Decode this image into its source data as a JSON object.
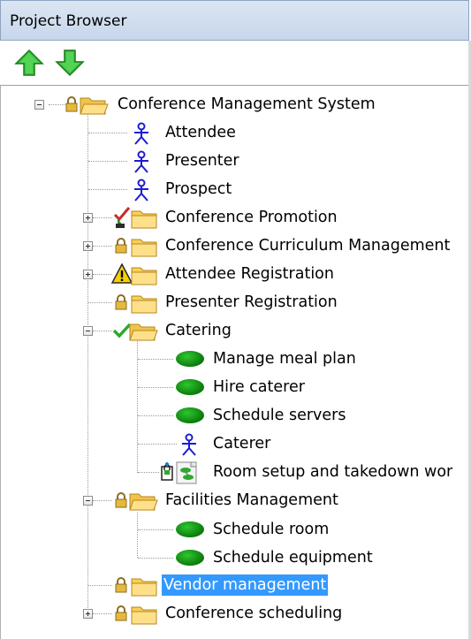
{
  "window": {
    "title": "Project Browser"
  },
  "toolbar": {
    "move_up_icon": "green-up-arrow",
    "move_down_icon": "green-down-arrow"
  },
  "tree": {
    "root": {
      "label": "Conference Management System",
      "state": "expanded",
      "children": [
        {
          "label": "Attendee",
          "icon": "actor"
        },
        {
          "label": "Presenter",
          "icon": "actor"
        },
        {
          "label": "Prospect",
          "icon": "actor"
        },
        {
          "label": "Conference Promotion",
          "icon": "package-checked-out",
          "state": "collapsed"
        },
        {
          "label": "Conference Curriculum Management",
          "icon": "package-locked",
          "state": "collapsed"
        },
        {
          "label": "Attendee Registration",
          "icon": "package-warning",
          "state": "collapsed"
        },
        {
          "label": "Presenter Registration",
          "icon": "package-locked"
        },
        {
          "label": "Catering",
          "icon": "package-checked",
          "state": "expanded",
          "children": [
            {
              "label": "Manage meal plan",
              "icon": "use-case"
            },
            {
              "label": "Hire caterer",
              "icon": "use-case"
            },
            {
              "label": "Schedule servers",
              "icon": "use-case"
            },
            {
              "label": "Caterer",
              "icon": "actor"
            },
            {
              "label": "Room setup and takedown wor",
              "icon": "diagram"
            }
          ]
        },
        {
          "label": "Facilities Management",
          "icon": "package-locked",
          "state": "expanded",
          "children": [
            {
              "label": "Schedule room",
              "icon": "use-case"
            },
            {
              "label": "Schedule equipment",
              "icon": "use-case"
            }
          ]
        },
        {
          "label": "Vendor management",
          "icon": "package-locked",
          "selected": true
        },
        {
          "label": "Conference scheduling",
          "icon": "package-locked",
          "state": "collapsed"
        }
      ]
    }
  },
  "colors": {
    "selection": "#3399ff",
    "title_bar": "#d0dcee",
    "use_case": "#17a317",
    "actor": "#1c1cd6",
    "folder": "#f5c542"
  }
}
